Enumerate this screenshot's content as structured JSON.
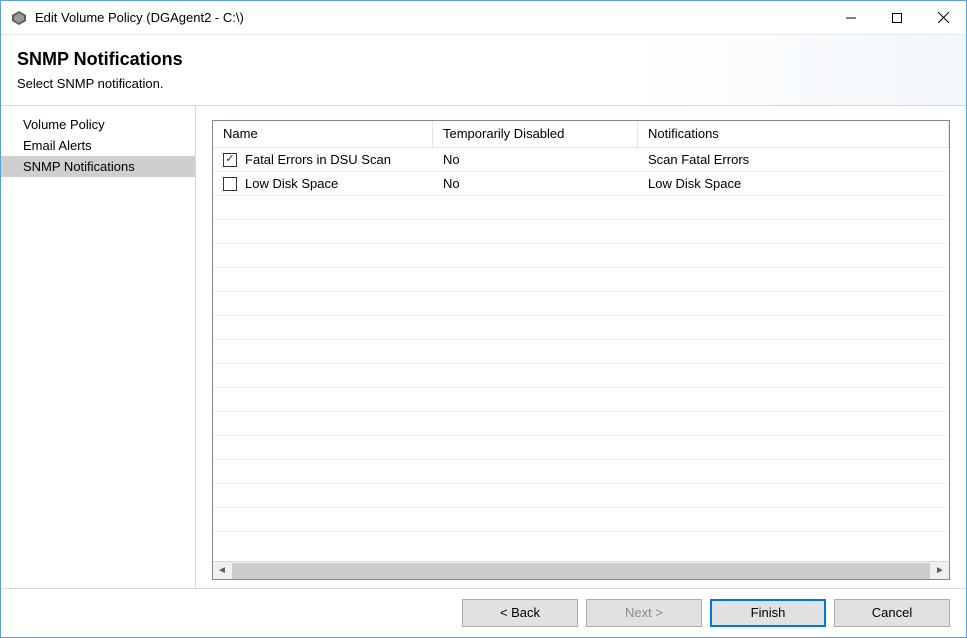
{
  "window": {
    "title": "Edit Volume Policy (DGAgent2 - C:\\)"
  },
  "header": {
    "title": "SNMP Notifications",
    "subtitle": "Select SNMP notification."
  },
  "sidebar": {
    "items": [
      {
        "label": "Volume Policy",
        "selected": false
      },
      {
        "label": "Email Alerts",
        "selected": false
      },
      {
        "label": "SNMP Notifications",
        "selected": true
      }
    ]
  },
  "table": {
    "columns": {
      "name": "Name",
      "disabled": "Temporarily Disabled",
      "notifications": "Notifications"
    },
    "rows": [
      {
        "checked": true,
        "name": "Fatal Errors in DSU Scan",
        "disabled": "No",
        "notifications": "Scan Fatal Errors"
      },
      {
        "checked": false,
        "name": "Low Disk Space",
        "disabled": "No",
        "notifications": "Low Disk Space"
      }
    ]
  },
  "footer": {
    "back": "< Back",
    "next": "Next >",
    "finish": "Finish",
    "cancel": "Cancel"
  }
}
